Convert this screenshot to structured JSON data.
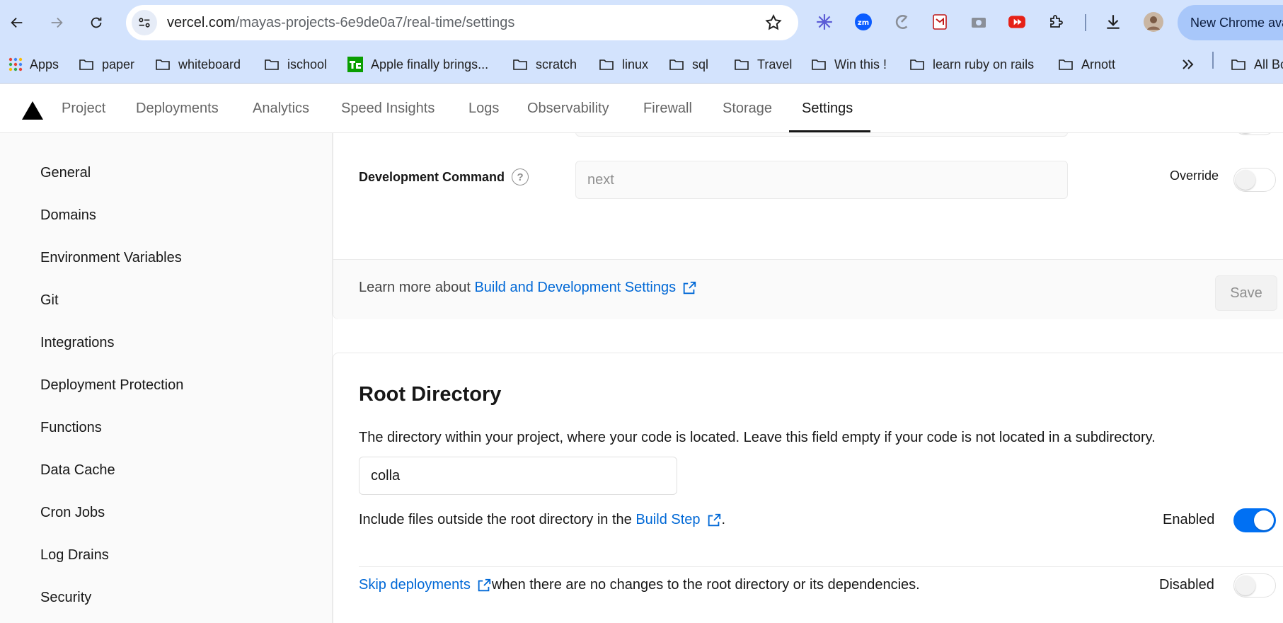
{
  "browser": {
    "url_host": "vercel.com",
    "url_path": "/mayas-projects-6e9de0a7/real-time/settings",
    "update_button": "New Chrome available",
    "bookmarks": [
      "Apps",
      "paper",
      "whiteboard",
      "ischool",
      "Apple finally brings...",
      "scratch",
      "linux",
      "sql",
      "Travel",
      "Win this !",
      "learn ruby on rails",
      "Arnott",
      "All Bookmarks"
    ]
  },
  "nav": {
    "tabs": [
      "Project",
      "Deployments",
      "Analytics",
      "Speed Insights",
      "Logs",
      "Observability",
      "Firewall",
      "Storage",
      "Settings"
    ],
    "active_tab": "Settings"
  },
  "sidebar": {
    "items": [
      "General",
      "Domains",
      "Environment Variables",
      "Git",
      "Integrations",
      "Deployment Protection",
      "Functions",
      "Data Cache",
      "Cron Jobs",
      "Log Drains",
      "Security"
    ]
  },
  "build_settings": {
    "dev_command_label": "Development Command",
    "dev_command_placeholder": "next",
    "override_label": "Override",
    "learn_more_prefix": "Learn more about ",
    "learn_more_link": "Build and Development Settings",
    "save_label": "Save"
  },
  "root_directory": {
    "title": "Root Directory",
    "description": "The directory within your project, where your code is located. Leave this field empty if your code is not located in a subdirectory.",
    "value": "colla",
    "include_prefix": "Include files outside the root directory in the ",
    "include_link": "Build Step",
    "include_suffix": ".",
    "include_state": "Enabled",
    "skip_link": "Skip deployments",
    "skip_suffix": " when there are no changes to the root directory or its dependencies.",
    "skip_state": "Disabled"
  },
  "colors": {
    "accent": "#0070f3",
    "link": "#0068d6",
    "chrome": "#d3e3fd"
  }
}
